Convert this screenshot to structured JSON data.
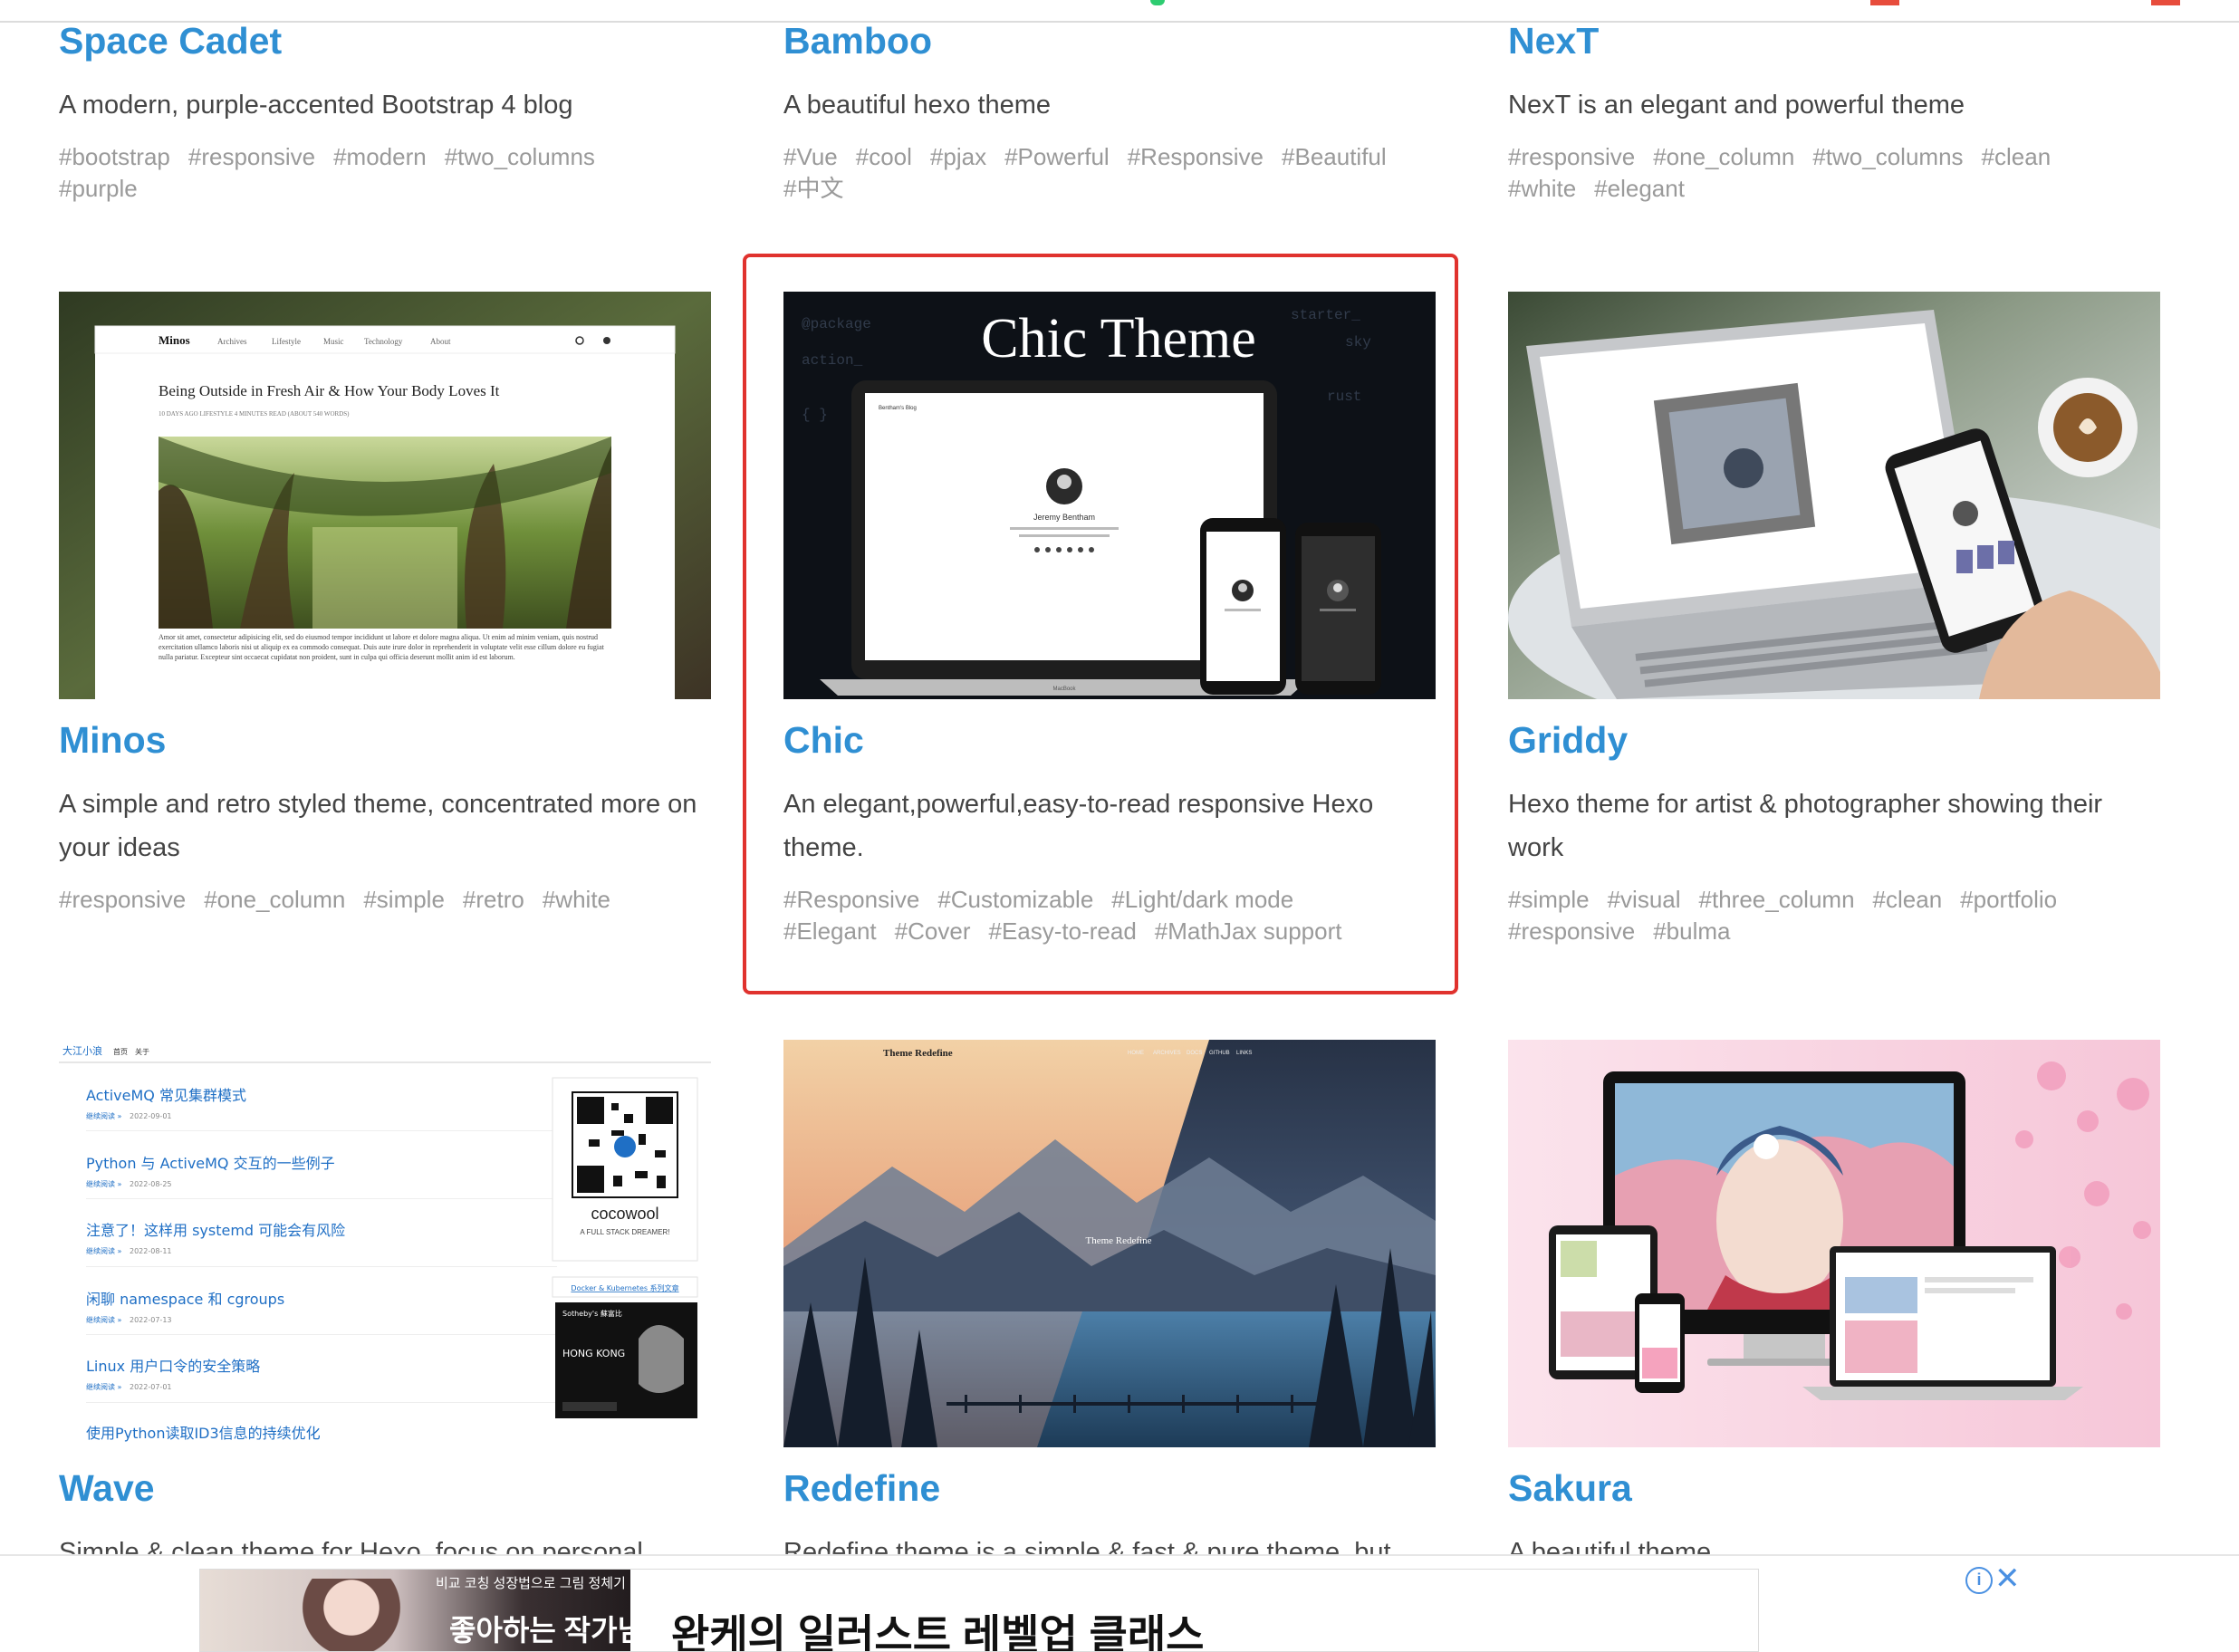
{
  "colors": {
    "title": "#2f8fd3",
    "tag": "#9a9a9a",
    "highlight": "#e0322e"
  },
  "themes": [
    {
      "name": "Space Cadet",
      "desc": "A modern, purple-accented Bootstrap 4 blog",
      "tags": [
        "#bootstrap",
        "#responsive",
        "#modern",
        "#two_columns",
        "#purple"
      ]
    },
    {
      "name": "Bamboo",
      "desc": "A beautiful hexo theme",
      "tags": [
        "#Vue",
        "#cool",
        "#pjax",
        "#Powerful",
        "#Responsive",
        "#Beautiful",
        "#中文"
      ]
    },
    {
      "name": "NexT",
      "desc": "NexT is an elegant and powerful theme",
      "tags": [
        "#responsive",
        "#one_column",
        "#two_columns",
        "#clean",
        "#white",
        "#elegant"
      ]
    },
    {
      "name": "Minos",
      "desc": "A simple and retro styled theme, concentrated more on your ideas",
      "tags": [
        "#responsive",
        "#one_column",
        "#simple",
        "#retro",
        "#white"
      ],
      "preview": {
        "logo": "Minos",
        "nav": [
          "Archives",
          "Lifestyle",
          "Music",
          "Technology",
          "About"
        ],
        "post_title": "Being Outside in Fresh Air & How Your Body Loves It",
        "post_meta": "10 DAYS AGO  LIFESTYLE  4 MINUTES READ (ABOUT 540 WORDS)",
        "body": "Amor sit amet, consectetur adipisicing elit, sed do eiusmod tempor incididunt ut labore et dolore magna aliqua. Ut enim ad minim veniam, quis nostrud exercitation ullamco laboris nisi ut aliquip ex ea commodo consequat. Duis aute irure dolor in reprehenderit in voluptate velit esse cillum dolore eu fugiat nulla pariatur. Excepteur sint occaecat cupidatat non proident, sunt in culpa qui officia deserunt mollit anim id est laborum."
      }
    },
    {
      "name": "Chic",
      "desc": "An elegant,powerful,easy-to-read responsive Hexo theme.",
      "tags": [
        "#Responsive",
        "#Customizable",
        "#Light/dark mode",
        "#Elegant",
        "#Cover",
        "#Easy-to-read",
        "#MathJax support"
      ],
      "preview": {
        "headline": "Chic Theme",
        "author": "Jeremy Bentham",
        "site": "Bentham's Blog",
        "laptop_label": "MacBook"
      }
    },
    {
      "name": "Griddy",
      "desc": "Hexo theme for artist & photographer showing their work",
      "tags": [
        "#simple",
        "#visual",
        "#three_column",
        "#clean",
        "#portfolio",
        "#responsive",
        "#bulma"
      ]
    },
    {
      "name": "Wave",
      "desc": "Simple & clean theme for Hexo, focus on personal",
      "tags": [],
      "preview": {
        "site": "大江小浪",
        "nav": [
          "首页",
          "关于"
        ],
        "posts": [
          {
            "title": "ActiveMQ 常见集群模式",
            "date": "2022-09-01"
          },
          {
            "title": "Python 与 ActiveMQ 交互的一些例子",
            "date": "2022-08-25"
          },
          {
            "title": "注意了！这样用 systemd 可能会有风险",
            "date": "2022-08-11"
          },
          {
            "title": "闲聊 namespace 和 cgroups",
            "date": "2022-07-13"
          },
          {
            "title": "Linux 用户口令的安全策略",
            "date": "2022-07-01"
          },
          {
            "title": "使用Python读取ID3信息的持续优化",
            "date": ""
          }
        ],
        "meta": "继续阅读 »",
        "qr_name": "cocowool",
        "qr_sub": "A FULL STACK DREAMER!",
        "link": "Docker & Kubernetes 系列文章",
        "ad_brand": "Sotheby's 蘇富比",
        "ad_city": "HONG KONG"
      }
    },
    {
      "name": "Redefine",
      "desc": "Redefine theme is a simple & fast & pure theme, but",
      "tags": [],
      "preview": {
        "site": "Theme Redefine",
        "center": "Theme Redefine",
        "nav": [
          "HOME",
          "ARCHIVES",
          "DOCS",
          "GITHUB",
          "LINKS"
        ]
      }
    },
    {
      "name": "Sakura",
      "desc": "A beautiful theme",
      "tags": []
    }
  ],
  "ad": {
    "small": "비교 코칭 성장법으로 그림 정체기 벗어나기",
    "big": "좋아하는 작가님",
    "text": "완케의 일러스트 레벨업 클래스",
    "info_icon": "info-icon",
    "close_icon": "close-icon"
  }
}
